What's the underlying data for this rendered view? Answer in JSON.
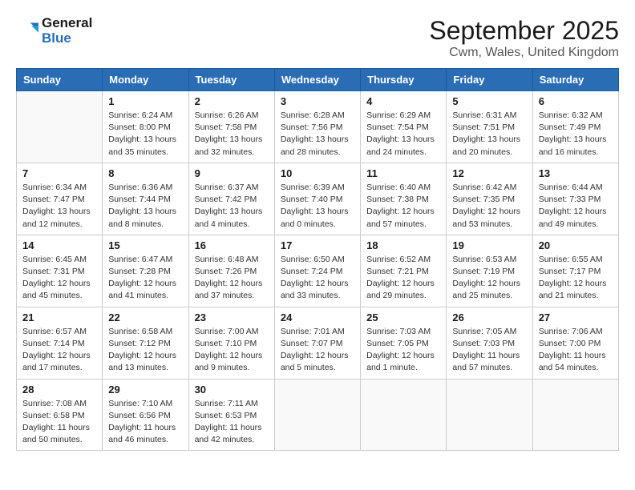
{
  "header": {
    "logo_line1": "General",
    "logo_line2": "Blue",
    "month": "September 2025",
    "location": "Cwm, Wales, United Kingdom"
  },
  "weekdays": [
    "Sunday",
    "Monday",
    "Tuesday",
    "Wednesday",
    "Thursday",
    "Friday",
    "Saturday"
  ],
  "weeks": [
    [
      {
        "day": "",
        "sunrise": "",
        "sunset": "",
        "daylight": ""
      },
      {
        "day": "1",
        "sunrise": "Sunrise: 6:24 AM",
        "sunset": "Sunset: 8:00 PM",
        "daylight": "Daylight: 13 hours and 35 minutes."
      },
      {
        "day": "2",
        "sunrise": "Sunrise: 6:26 AM",
        "sunset": "Sunset: 7:58 PM",
        "daylight": "Daylight: 13 hours and 32 minutes."
      },
      {
        "day": "3",
        "sunrise": "Sunrise: 6:28 AM",
        "sunset": "Sunset: 7:56 PM",
        "daylight": "Daylight: 13 hours and 28 minutes."
      },
      {
        "day": "4",
        "sunrise": "Sunrise: 6:29 AM",
        "sunset": "Sunset: 7:54 PM",
        "daylight": "Daylight: 13 hours and 24 minutes."
      },
      {
        "day": "5",
        "sunrise": "Sunrise: 6:31 AM",
        "sunset": "Sunset: 7:51 PM",
        "daylight": "Daylight: 13 hours and 20 minutes."
      },
      {
        "day": "6",
        "sunrise": "Sunrise: 6:32 AM",
        "sunset": "Sunset: 7:49 PM",
        "daylight": "Daylight: 13 hours and 16 minutes."
      }
    ],
    [
      {
        "day": "7",
        "sunrise": "Sunrise: 6:34 AM",
        "sunset": "Sunset: 7:47 PM",
        "daylight": "Daylight: 13 hours and 12 minutes."
      },
      {
        "day": "8",
        "sunrise": "Sunrise: 6:36 AM",
        "sunset": "Sunset: 7:44 PM",
        "daylight": "Daylight: 13 hours and 8 minutes."
      },
      {
        "day": "9",
        "sunrise": "Sunrise: 6:37 AM",
        "sunset": "Sunset: 7:42 PM",
        "daylight": "Daylight: 13 hours and 4 minutes."
      },
      {
        "day": "10",
        "sunrise": "Sunrise: 6:39 AM",
        "sunset": "Sunset: 7:40 PM",
        "daylight": "Daylight: 13 hours and 0 minutes."
      },
      {
        "day": "11",
        "sunrise": "Sunrise: 6:40 AM",
        "sunset": "Sunset: 7:38 PM",
        "daylight": "Daylight: 12 hours and 57 minutes."
      },
      {
        "day": "12",
        "sunrise": "Sunrise: 6:42 AM",
        "sunset": "Sunset: 7:35 PM",
        "daylight": "Daylight: 12 hours and 53 minutes."
      },
      {
        "day": "13",
        "sunrise": "Sunrise: 6:44 AM",
        "sunset": "Sunset: 7:33 PM",
        "daylight": "Daylight: 12 hours and 49 minutes."
      }
    ],
    [
      {
        "day": "14",
        "sunrise": "Sunrise: 6:45 AM",
        "sunset": "Sunset: 7:31 PM",
        "daylight": "Daylight: 12 hours and 45 minutes."
      },
      {
        "day": "15",
        "sunrise": "Sunrise: 6:47 AM",
        "sunset": "Sunset: 7:28 PM",
        "daylight": "Daylight: 12 hours and 41 minutes."
      },
      {
        "day": "16",
        "sunrise": "Sunrise: 6:48 AM",
        "sunset": "Sunset: 7:26 PM",
        "daylight": "Daylight: 12 hours and 37 minutes."
      },
      {
        "day": "17",
        "sunrise": "Sunrise: 6:50 AM",
        "sunset": "Sunset: 7:24 PM",
        "daylight": "Daylight: 12 hours and 33 minutes."
      },
      {
        "day": "18",
        "sunrise": "Sunrise: 6:52 AM",
        "sunset": "Sunset: 7:21 PM",
        "daylight": "Daylight: 12 hours and 29 minutes."
      },
      {
        "day": "19",
        "sunrise": "Sunrise: 6:53 AM",
        "sunset": "Sunset: 7:19 PM",
        "daylight": "Daylight: 12 hours and 25 minutes."
      },
      {
        "day": "20",
        "sunrise": "Sunrise: 6:55 AM",
        "sunset": "Sunset: 7:17 PM",
        "daylight": "Daylight: 12 hours and 21 minutes."
      }
    ],
    [
      {
        "day": "21",
        "sunrise": "Sunrise: 6:57 AM",
        "sunset": "Sunset: 7:14 PM",
        "daylight": "Daylight: 12 hours and 17 minutes."
      },
      {
        "day": "22",
        "sunrise": "Sunrise: 6:58 AM",
        "sunset": "Sunset: 7:12 PM",
        "daylight": "Daylight: 12 hours and 13 minutes."
      },
      {
        "day": "23",
        "sunrise": "Sunrise: 7:00 AM",
        "sunset": "Sunset: 7:10 PM",
        "daylight": "Daylight: 12 hours and 9 minutes."
      },
      {
        "day": "24",
        "sunrise": "Sunrise: 7:01 AM",
        "sunset": "Sunset: 7:07 PM",
        "daylight": "Daylight: 12 hours and 5 minutes."
      },
      {
        "day": "25",
        "sunrise": "Sunrise: 7:03 AM",
        "sunset": "Sunset: 7:05 PM",
        "daylight": "Daylight: 12 hours and 1 minute."
      },
      {
        "day": "26",
        "sunrise": "Sunrise: 7:05 AM",
        "sunset": "Sunset: 7:03 PM",
        "daylight": "Daylight: 11 hours and 57 minutes."
      },
      {
        "day": "27",
        "sunrise": "Sunrise: 7:06 AM",
        "sunset": "Sunset: 7:00 PM",
        "daylight": "Daylight: 11 hours and 54 minutes."
      }
    ],
    [
      {
        "day": "28",
        "sunrise": "Sunrise: 7:08 AM",
        "sunset": "Sunset: 6:58 PM",
        "daylight": "Daylight: 11 hours and 50 minutes."
      },
      {
        "day": "29",
        "sunrise": "Sunrise: 7:10 AM",
        "sunset": "Sunset: 6:56 PM",
        "daylight": "Daylight: 11 hours and 46 minutes."
      },
      {
        "day": "30",
        "sunrise": "Sunrise: 7:11 AM",
        "sunset": "Sunset: 6:53 PM",
        "daylight": "Daylight: 11 hours and 42 minutes."
      },
      {
        "day": "",
        "sunrise": "",
        "sunset": "",
        "daylight": ""
      },
      {
        "day": "",
        "sunrise": "",
        "sunset": "",
        "daylight": ""
      },
      {
        "day": "",
        "sunrise": "",
        "sunset": "",
        "daylight": ""
      },
      {
        "day": "",
        "sunrise": "",
        "sunset": "",
        "daylight": ""
      }
    ]
  ]
}
